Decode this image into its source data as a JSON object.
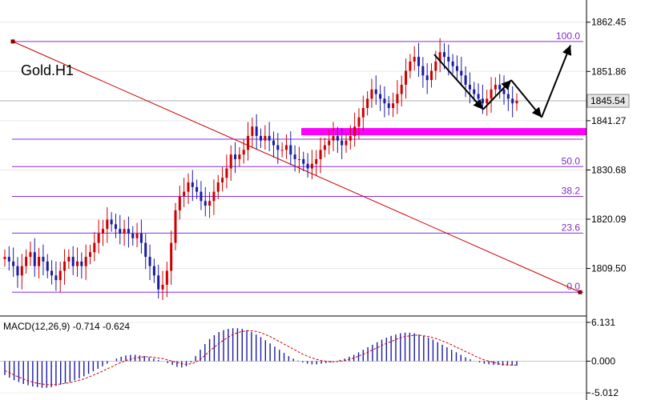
{
  "chart_data": [
    {
      "type": "line",
      "symbol_label": "Gold.H1",
      "y_ticks": [
        "1862.45",
        "1851.86",
        "1841.27",
        "1830.68",
        "1820.09",
        "1809.50"
      ],
      "current_price": "1845.54",
      "ylim": [
        1801.0,
        1865.5
      ],
      "fib_levels": [
        {
          "label": "100.0",
          "price": 1858.3
        },
        {
          "label": "",
          "price": 1837.3
        },
        {
          "label": "50.0",
          "price": 1831.4
        },
        {
          "label": "38.2",
          "price": 1825.0
        },
        {
          "label": "23.6",
          "price": 1817.1
        },
        {
          "label": "0.0",
          "price": 1804.4
        }
      ],
      "support_zone": 1839.0,
      "bars_close": [
        1812,
        1811,
        1810,
        1808,
        1810,
        1812,
        1813,
        1810,
        1812,
        1811,
        1809,
        1808,
        1807,
        1809,
        1811,
        1812,
        1810,
        1811,
        1810,
        1812,
        1813,
        1815,
        1817,
        1818,
        1820,
        1819,
        1818,
        1817,
        1818,
        1817,
        1816,
        1817,
        1815,
        1812,
        1810,
        1808,
        1805,
        1806,
        1809,
        1815,
        1822,
        1825,
        1826,
        1828,
        1827,
        1826,
        1824,
        1823,
        1824,
        1826,
        1828,
        1829,
        1831,
        1834,
        1833,
        1834,
        1835,
        1838,
        1840,
        1838,
        1837,
        1838,
        1837,
        1836,
        1835,
        1835,
        1836,
        1834,
        1833,
        1833,
        1832,
        1831,
        1832,
        1833,
        1835,
        1836,
        1837,
        1838,
        1837,
        1836,
        1837,
        1838,
        1840,
        1842,
        1844,
        1846,
        1848,
        1847,
        1846,
        1845,
        1844,
        1845,
        1847,
        1849,
        1852,
        1854,
        1855,
        1853,
        1851,
        1850,
        1852,
        1854,
        1856,
        1855,
        1854,
        1853,
        1852,
        1851,
        1849,
        1848,
        1847,
        1846,
        1845,
        1846,
        1848,
        1849,
        1848,
        1847,
        1846,
        1845,
        1845.54
      ],
      "annotations": {
        "diagonal_line": {
          "start_price": 1858.3,
          "end_price": 1804.4
        },
        "path_arrows": [
          [
            1855.5,
            1843.7
          ],
          [
            1843.7,
            1850.0
          ],
          [
            1850.0,
            1842.0
          ],
          [
            1842.0,
            1857.5
          ]
        ]
      }
    },
    {
      "type": "bar",
      "title": "MACD(12,26,9) -0.714 -0.624",
      "y_ticks": [
        "6.131",
        "0.000",
        "-5.012"
      ],
      "ylim": [
        -5.5,
        6.5
      ],
      "histogram": [
        -2.2,
        -2.6,
        -3.0,
        -3.3,
        -3.6,
        -3.8,
        -4.0,
        -4.1,
        -4.2,
        -4.2,
        -4.1,
        -3.9,
        -3.7,
        -3.5,
        -3.3,
        -3.0,
        -2.7,
        -2.4,
        -2.0,
        -1.6,
        -1.2,
        -0.8,
        -0.4,
        0.0,
        0.4,
        0.7,
        0.9,
        1.0,
        1.0,
        0.9,
        0.8,
        0.6,
        0.4,
        0.2,
        0.0,
        -0.3,
        -0.6,
        -0.9,
        -1.0,
        -0.8,
        -0.2,
        0.8,
        1.8,
        2.7,
        3.5,
        4.1,
        4.6,
        4.9,
        5.1,
        5.2,
        5.2,
        5.1,
        4.9,
        4.6,
        4.2,
        3.8,
        3.3,
        2.8,
        2.3,
        1.8,
        1.3,
        0.8,
        0.4,
        0.1,
        -0.2,
        -0.4,
        -0.5,
        -0.5,
        -0.4,
        -0.3,
        -0.2,
        0.0,
        0.2,
        0.4,
        0.7,
        1.0,
        1.4,
        1.8,
        2.2,
        2.6,
        3.0,
        3.4,
        3.7,
        4.0,
        4.2,
        4.4,
        4.5,
        4.5,
        4.4,
        4.2,
        4.0,
        3.7,
        3.4,
        3.0,
        2.6,
        2.2,
        1.8,
        1.4,
        1.0,
        0.6,
        0.3,
        0.0,
        -0.2,
        -0.4,
        -0.5,
        -0.6,
        -0.6,
        -0.7,
        -0.7,
        -0.7,
        -0.7
      ],
      "signal": [
        -1.5,
        -1.8,
        -2.2,
        -2.5,
        -2.8,
        -3.1,
        -3.3,
        -3.5,
        -3.6,
        -3.7,
        -3.7,
        -3.7,
        -3.6,
        -3.5,
        -3.4,
        -3.2,
        -3.0,
        -2.8,
        -2.5,
        -2.2,
        -1.9,
        -1.6,
        -1.2,
        -0.9,
        -0.5,
        -0.2,
        0.1,
        0.3,
        0.5,
        0.6,
        0.7,
        0.7,
        0.6,
        0.5,
        0.4,
        0.2,
        0.0,
        -0.2,
        -0.4,
        -0.5,
        -0.4,
        -0.2,
        0.3,
        0.9,
        1.6,
        2.2,
        2.8,
        3.3,
        3.8,
        4.2,
        4.5,
        4.7,
        4.8,
        4.8,
        4.7,
        4.5,
        4.2,
        3.9,
        3.5,
        3.1,
        2.7,
        2.3,
        1.9,
        1.5,
        1.1,
        0.8,
        0.5,
        0.3,
        0.1,
        0.0,
        -0.1,
        -0.1,
        0.0,
        0.1,
        0.3,
        0.5,
        0.8,
        1.1,
        1.4,
        1.8,
        2.1,
        2.5,
        2.8,
        3.1,
        3.4,
        3.7,
        3.9,
        4.0,
        4.1,
        4.1,
        4.0,
        3.9,
        3.7,
        3.5,
        3.2,
        2.9,
        2.6,
        2.2,
        1.9,
        1.5,
        1.2,
        0.8,
        0.5,
        0.2,
        0.0,
        -0.2,
        -0.4,
        -0.5,
        -0.6,
        -0.6,
        -0.62
      ]
    }
  ],
  "colors": {
    "candle_up": "#cc0000",
    "candle_down": "#1a1aa6",
    "fib": "#8a2be2",
    "trend": "#cc0000",
    "support": "#ff00ff",
    "macd_hist": "#1a1aa6",
    "macd_signal": "#cc0000"
  }
}
